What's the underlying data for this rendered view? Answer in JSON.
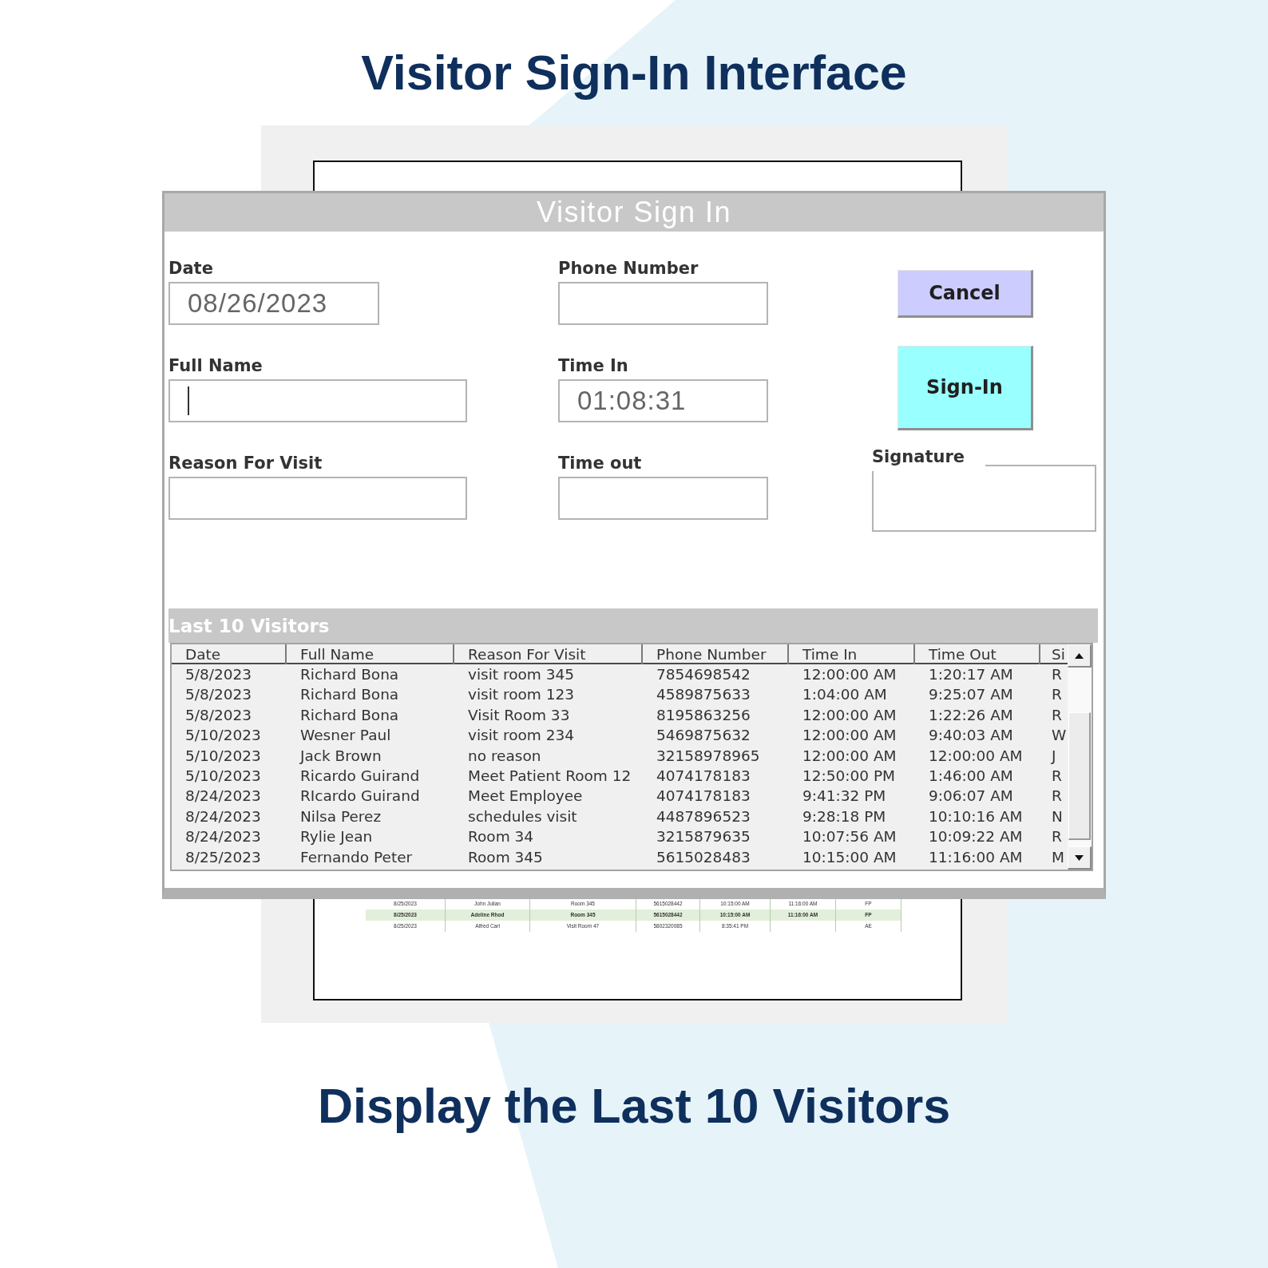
{
  "page": {
    "heading": "Visitor Sign-In Interface",
    "caption": "Display the Last 10 Visitors"
  },
  "window": {
    "title": "Visitor Sign In"
  },
  "form": {
    "fields": [
      {
        "label": "Date",
        "value": "08/26/2023",
        "focused": false
      },
      {
        "label": "Phone Number",
        "focused": false
      },
      {
        "label": "Full Name",
        "focused": true
      },
      {
        "label": "Time In",
        "value": "01:08:31",
        "focused": false
      },
      {
        "label": "Reason For Visit",
        "focused": false
      },
      {
        "label": "Time out",
        "focused": false
      }
    ],
    "buttons": [
      {
        "label": "Cancel",
        "kind": "cancel"
      },
      {
        "label": "Sign-In",
        "kind": "submit"
      }
    ],
    "signature": {
      "label": "Signature"
    }
  },
  "recent_visitors": {
    "title": "Last 10 Visitors",
    "columns": [
      "Date",
      "Full Name",
      "Reason For Visit",
      "Phone Number",
      "Time In",
      "Time Out",
      "Si"
    ],
    "rows": [
      [
        "5/8/2023",
        "Richard Bona",
        "visit room 345",
        "7854698542",
        "12:00:00 AM",
        "1:20:17 AM",
        "R"
      ],
      [
        "5/8/2023",
        "Richard Bona",
        "visit room 123",
        "4589875633",
        "1:04:00 AM",
        "9:25:07 AM",
        "R"
      ],
      [
        "5/8/2023",
        "Richard Bona",
        "Visit Room 33",
        "8195863256",
        "12:00:00 AM",
        "1:22:26 AM",
        "R"
      ],
      [
        "5/10/2023",
        "Wesner Paul",
        "visit room 234",
        "5469875632",
        "12:00:00 AM",
        "9:40:03 AM",
        "W"
      ],
      [
        "5/10/2023",
        "Jack Brown",
        "no reason",
        "32158978965",
        "12:00:00 AM",
        "12:00:00 AM",
        "J"
      ],
      [
        "5/10/2023",
        "Ricardo Guirand",
        "Meet Patient Room 12",
        "4074178183",
        "12:50:00 PM",
        "1:46:00 AM",
        "R"
      ],
      [
        "8/24/2023",
        "RIcardo Guirand",
        "Meet Employee",
        "4074178183",
        "9:41:32 PM",
        "9:06:07 AM",
        "R"
      ],
      [
        "8/24/2023",
        "Nilsa Perez",
        "schedules visit",
        "4487896523",
        "9:28:18 PM",
        "10:10:16 AM",
        "N"
      ],
      [
        "8/24/2023",
        "Rylie Jean",
        "Room 34",
        "3215879635",
        "10:07:56 AM",
        "10:09:22 AM",
        "R"
      ],
      [
        "8/25/2023",
        "Fernando Peter",
        "Room 345",
        "5615028483",
        "10:15:00 AM",
        "11:16:00 AM",
        "M"
      ]
    ]
  },
  "background_sheet": {
    "rows": [
      {
        "highlighted": false,
        "column_1": "8/25/2023",
        "column_2": "John Julian",
        "column_3": "Room 345",
        "column_4": "5615028442",
        "column_5": "10:15:00 AM",
        "column_6": "11:16:00 AM",
        "column_7": "FP"
      },
      {
        "highlighted": true,
        "column_1": "8/25/2023",
        "column_2": "Adeline Rhod",
        "column_3": "Room 345",
        "column_4": "5615028442",
        "column_5": "10:15:00 AM",
        "column_6": "11:16:00 AM",
        "column_7": "FP"
      },
      {
        "highlighted": false,
        "column_1": "8/25/2023",
        "column_2": "Alfred Carl",
        "column_3": "Visit Room 47",
        "column_4": "5802320085",
        "column_5": "8:35:41 PM",
        "column_7": "AE"
      }
    ]
  }
}
